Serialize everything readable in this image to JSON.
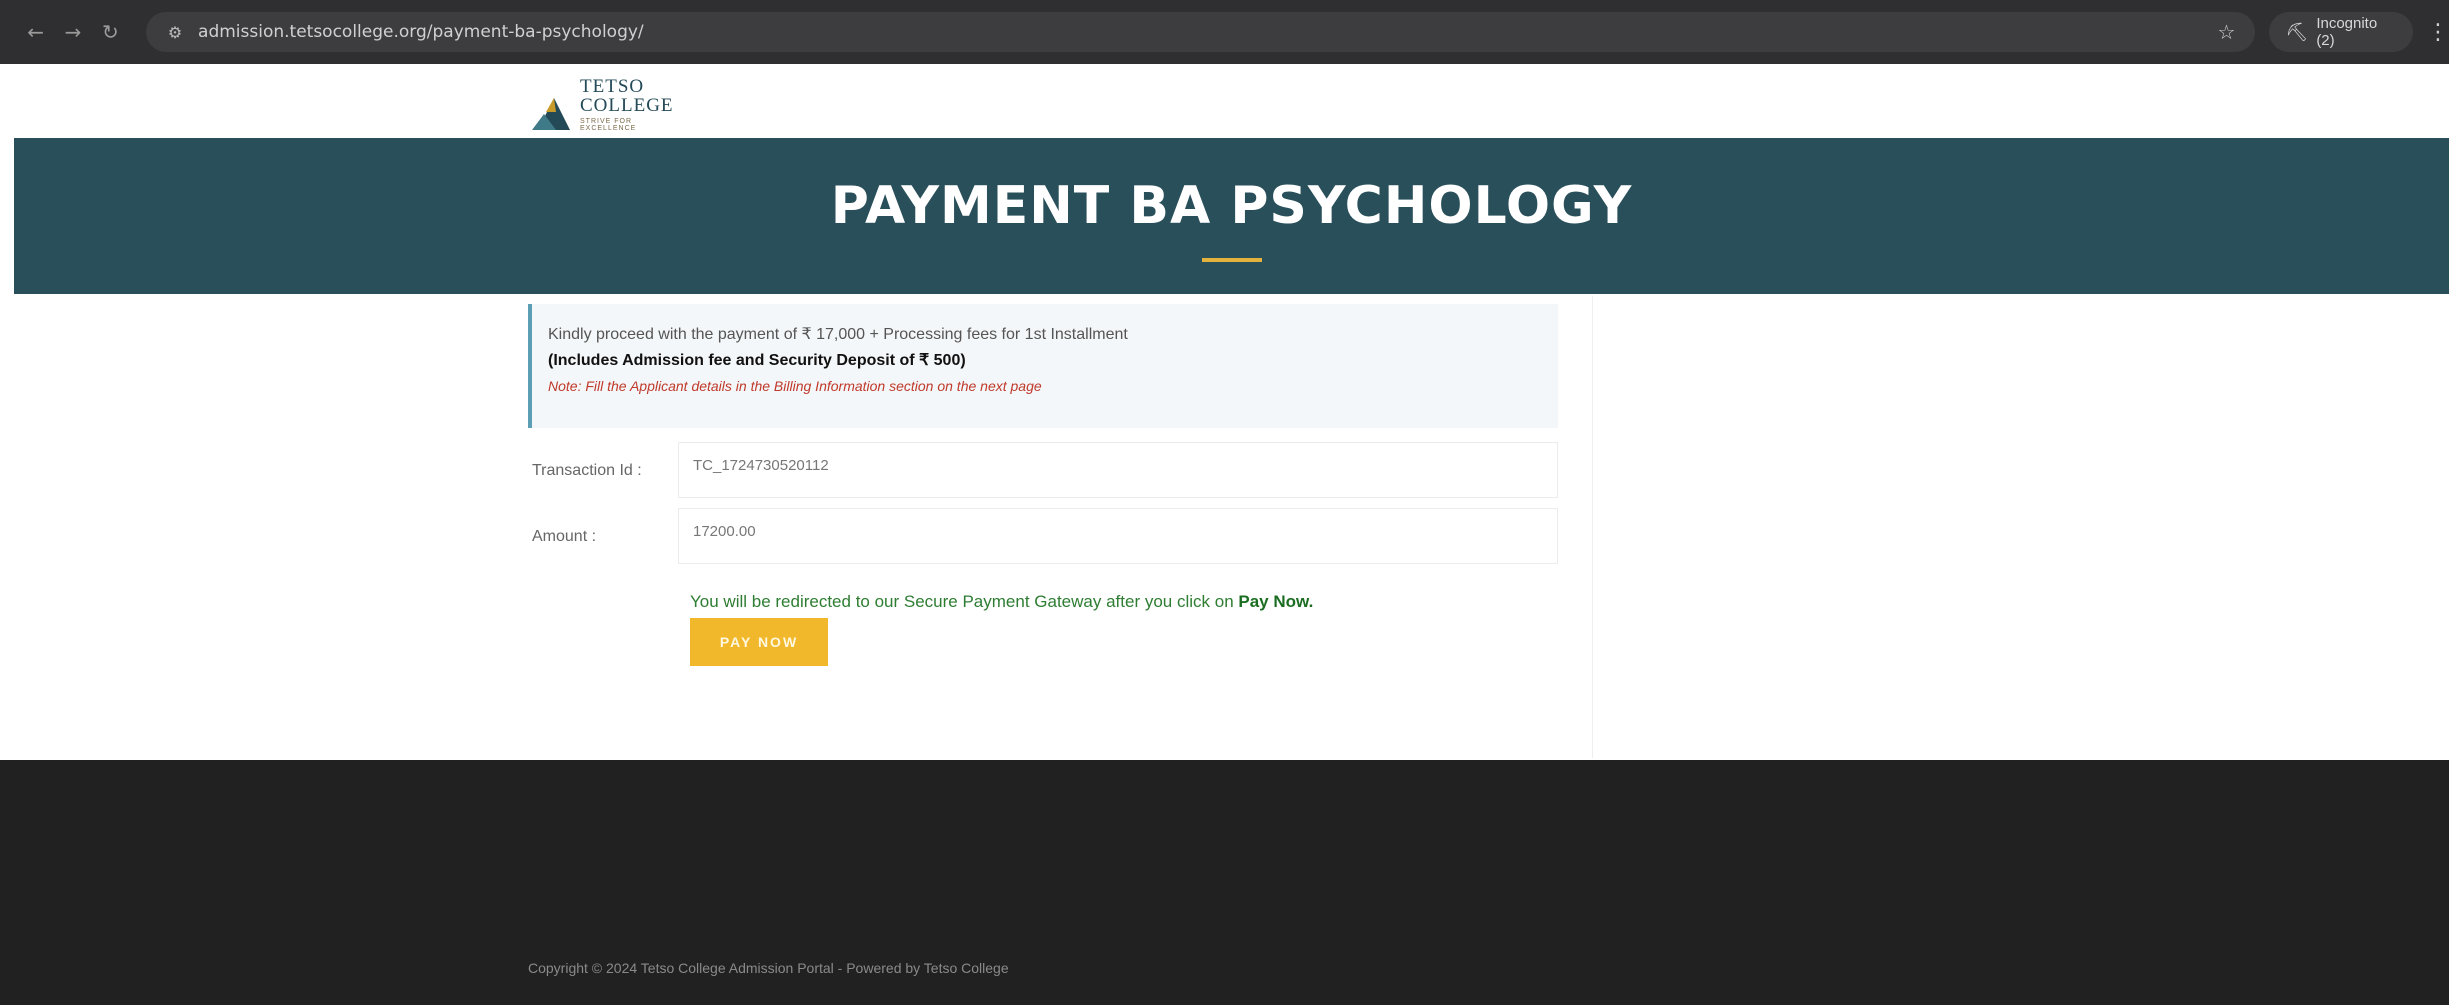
{
  "browser": {
    "url": "admission.tetsocollege.org/payment-ba-psychology/",
    "incognito_label": "Incognito (2)"
  },
  "header": {
    "logo_word1": "TETSO",
    "logo_word2": "COLLEGE",
    "logo_tagline": "STRIVE FOR EXCELLENCE"
  },
  "banner": {
    "title": "PAYMENT BA PSYCHOLOGY"
  },
  "notice": {
    "line1": "Kindly proceed with the payment of ₹ 17,000 + Processing fees for 1st Installment",
    "line2": "(Includes Admission fee and Security Deposit of ₹ 500)",
    "line3": "Note: Fill the Applicant details in the Billing Information section on the next page"
  },
  "form": {
    "transaction_label": "Transaction Id :",
    "transaction_value": "TC_1724730520112",
    "amount_label": "Amount :",
    "amount_value": "17200.00"
  },
  "redirect": {
    "text": "You will be redirected to our Secure Payment Gateway after you click on ",
    "emphasis": "Pay Now."
  },
  "pay_button": {
    "label": "PAY NOW"
  },
  "footer": {
    "copyright": "Copyright © 2024 Tetso College Admission Portal - Powered by Tetso College"
  },
  "colors": {
    "banner": "#284f5a",
    "accent_underline": "#e2b23c",
    "pay_button": "#f2b82b",
    "footer": "#212121",
    "note_red": "#c0392b",
    "redirect_green": "#2e7d32"
  },
  "icons": [
    "back-arrow-icon",
    "forward-arrow-icon",
    "reload-icon",
    "site-info-icon",
    "bookmark-star-icon",
    "incognito-icon",
    "kebab-menu-icon"
  ]
}
